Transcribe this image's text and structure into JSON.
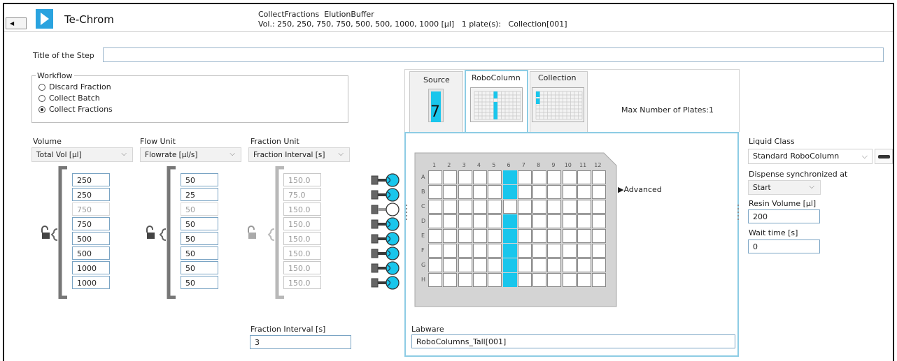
{
  "header": {
    "collapse_glyph": "◀",
    "app_name": "Te-Chrom",
    "summary_line1": "CollectFractions  ElutionBuffer",
    "summary_line2": "Vol.: 250, 250, 750, 750, 500, 500, 1000, 1000 [µl]   1 plate(s):   Collection[001]"
  },
  "step": {
    "title_label": "Title of the Step",
    "title_value": ""
  },
  "workflow": {
    "legend": "Workflow",
    "options": [
      "Discard Fraction",
      "Collect Batch",
      "Collect Fractions"
    ],
    "selected": "Collect Fractions"
  },
  "volume": {
    "label": "Volume",
    "select": "Total Vol [µl]",
    "values": [
      "250",
      "250",
      "750",
      "750",
      "500",
      "500",
      "1000",
      "1000"
    ],
    "lock_icon": "open-lock-icon"
  },
  "flow": {
    "label": "Flow Unit",
    "select": "Flowrate [µl/s]",
    "values": [
      "50",
      "25",
      "50",
      "50",
      "50",
      "50",
      "50",
      "50"
    ]
  },
  "fraction": {
    "label": "Fraction Unit",
    "select": "Fraction Interval [s]",
    "values": [
      "150.0",
      "75.0",
      "150.0",
      "150.0",
      "150.0",
      "150.0",
      "150.0",
      "150.0"
    ],
    "interval_label": "Fraction Interval [s]",
    "interval_value": "3"
  },
  "tabs": {
    "source": "Source",
    "source_count": "7",
    "robocolumn": "RoboColumn",
    "collection": "Collection"
  },
  "plate": {
    "max_plates": "Max Number of Plates:1",
    "advanced": "▶Advanced",
    "rows": [
      "A",
      "B",
      "C",
      "D",
      "E",
      "F",
      "G",
      "H"
    ],
    "cols": [
      "1",
      "2",
      "3",
      "4",
      "5",
      "6",
      "7",
      "8",
      "9",
      "10",
      "11",
      "12"
    ],
    "highlight_col": "6",
    "highlight_rows": [
      "A",
      "B",
      "D",
      "E",
      "F",
      "G",
      "H"
    ],
    "highlight_color": "#19c6ec",
    "labware_label": "Labware",
    "labware_value": "RoboColumns_Tall[001]"
  },
  "right": {
    "liquid_class_label": "Liquid Class",
    "liquid_class_value": "Standard RoboColumn",
    "dispense_label": "Dispense synchronized at",
    "dispense_value": "Start",
    "resin_label": "Resin Volume [µl]",
    "resin_value": "200",
    "wait_label": "Wait time [s]",
    "wait_value": "0"
  },
  "colors": {
    "accent": "#2aa3df",
    "well_on": "#19c6ec",
    "input_border": "#7aa4c4"
  }
}
